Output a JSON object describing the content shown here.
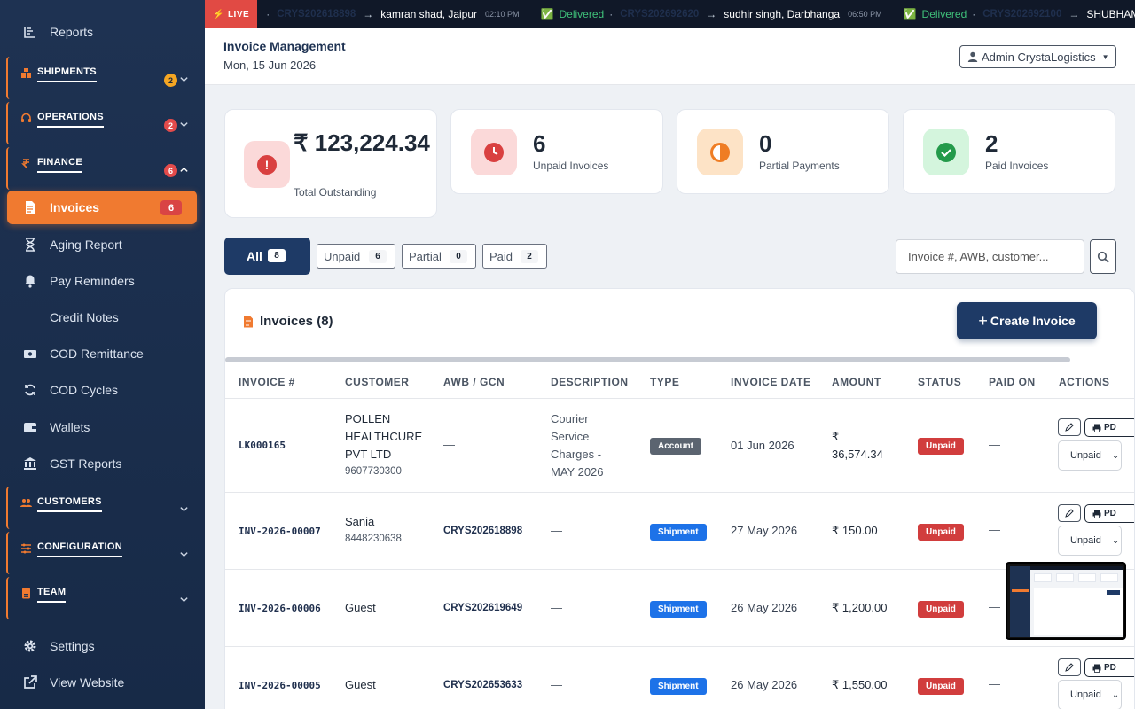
{
  "sidebar": {
    "reports": "Reports",
    "groups": {
      "shipments": {
        "label": "SHIPMENTS",
        "badge": "2"
      },
      "operations": {
        "label": "OPERATIONS",
        "badge": "2"
      },
      "finance": {
        "label": "FINANCE",
        "badge": "6"
      },
      "customers": {
        "label": "CUSTOMERS"
      },
      "configuration": {
        "label": "CONFIGURATION"
      },
      "team": {
        "label": "TEAM"
      }
    },
    "finance_items": [
      {
        "label": "Invoices",
        "badge": "6"
      },
      {
        "label": "Aging Report"
      },
      {
        "label": "Pay Reminders"
      },
      {
        "label": "Credit Notes"
      },
      {
        "label": "COD Remittance"
      },
      {
        "label": "COD Cycles"
      },
      {
        "label": "Wallets"
      },
      {
        "label": "GST Reports"
      }
    ],
    "settings": "Settings",
    "view_website": "View Website"
  },
  "ticker": {
    "live": "LIVE",
    "items": [
      {
        "awb": "CRYS202618898",
        "dest": "kamran shad, Jaipur",
        "time": "02:10 PM"
      },
      {
        "status": "Delivered",
        "awb": "CRYS202692620",
        "dest": "sudhir singh, Darbhanga",
        "time": "06:50 PM"
      },
      {
        "status": "Delivered",
        "awb": "CRYS202692100",
        "dest": "SHUBHAM, Fatehabad"
      }
    ]
  },
  "header": {
    "title": "Invoice Management",
    "date": "Mon, 15 Jun 2026",
    "user": "Admin CrystaLogistics"
  },
  "stats": [
    {
      "value": "₹ 123,224.34",
      "label": "Total Outstanding",
      "icon": "alert-icon"
    },
    {
      "value": "6",
      "label": "Unpaid Invoices",
      "icon": "clock-icon"
    },
    {
      "value": "0",
      "label": "Partial Payments",
      "icon": "half-circle-icon"
    },
    {
      "value": "2",
      "label": "Paid Invoices",
      "icon": "check-icon"
    }
  ],
  "filters": {
    "all": {
      "label": "All",
      "count": "8"
    },
    "unpaid": {
      "label": "Unpaid",
      "count": "6"
    },
    "partial": {
      "label": "Partial",
      "count": "0"
    },
    "paid": {
      "label": "Paid",
      "count": "2"
    },
    "search_placeholder": "Invoice #, AWB, customer..."
  },
  "panel": {
    "title": "Invoices (8)",
    "create_label": "Create Invoice",
    "columns": [
      "INVOICE #",
      "CUSTOMER",
      "AWB / GCN",
      "DESCRIPTION",
      "TYPE",
      "INVOICE DATE",
      "AMOUNT",
      "STATUS",
      "PAID ON",
      "ACTIONS"
    ],
    "rows": [
      {
        "invoice": "LK000165",
        "customer": "POLLEN HEALTHCURE PVT LTD",
        "customer_l1": "POLLEN",
        "customer_l2": "HEALTHCURE",
        "customer_l3": "PVT LTD",
        "phone": "9607730300",
        "awb": "—",
        "description": "Courier Service Charges - MAY 2026",
        "desc_l1": "Courier",
        "desc_l2": "Service",
        "desc_l3": "Charges -",
        "desc_l4": "MAY 2026",
        "type": "Account",
        "date": "01 Jun 2026",
        "amount": "₹ 36,574.34",
        "amount_l1": "₹",
        "amount_l2": "36,574.34",
        "status": "Unpaid",
        "paid_on": "—",
        "pdf": "PD",
        "action_status": "Unpaid"
      },
      {
        "invoice": "INV-2026-00007",
        "customer": "Sania",
        "phone": "8448230638",
        "awb": "CRYS202618898",
        "description": "—",
        "type": "Shipment",
        "date": "27 May 2026",
        "amount": "₹ 150.00",
        "status": "Unpaid",
        "paid_on": "—",
        "pdf": "PD",
        "action_status": "Unpaid"
      },
      {
        "invoice": "INV-2026-00006",
        "customer": "Guest",
        "awb": "CRYS202619649",
        "description": "—",
        "type": "Shipment",
        "date": "26 May 2026",
        "amount": "₹ 1,200.00",
        "status": "Unpaid",
        "paid_on": "—"
      },
      {
        "invoice": "INV-2026-00005",
        "customer": "Guest",
        "awb": "CRYS202653633",
        "description": "—",
        "type": "Shipment",
        "date": "26 May 2026",
        "amount": "₹ 1,550.00",
        "status": "Unpaid",
        "paid_on": "—",
        "pdf": "PD",
        "action_status": "Unpaid"
      }
    ]
  },
  "colors": {
    "accent": "#f07a30",
    "navy": "#1e3a66",
    "sidebar": "#1e3252",
    "danger": "#d13d3d",
    "shipment": "#1d72e8"
  }
}
